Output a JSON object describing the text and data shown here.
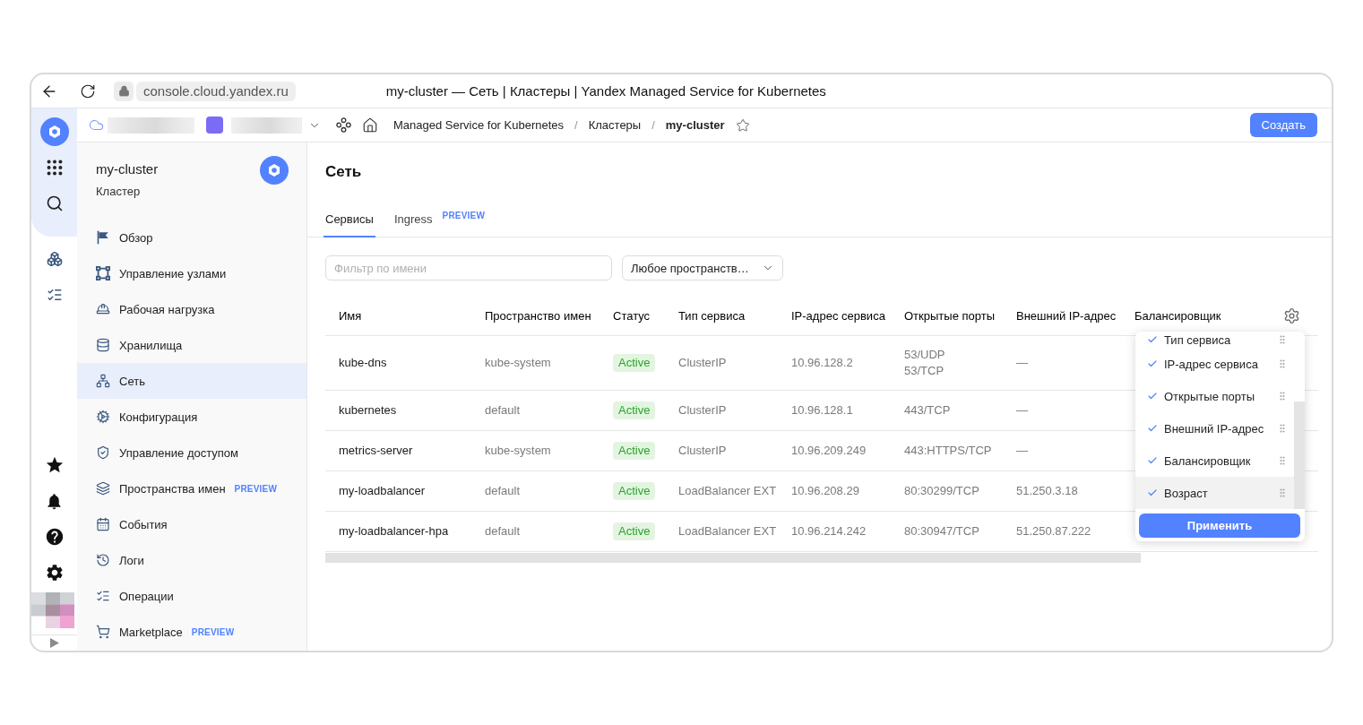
{
  "browser": {
    "url": "console.cloud.yandex.ru",
    "title": "my-cluster — Сеть | Кластеры | Yandex Managed Service for Kubernetes"
  },
  "header": {
    "breadcrumbs": [
      {
        "label": "Managed Service for Kubernetes",
        "current": false
      },
      {
        "separator": "/",
        "label": "Кластеры",
        "current": false
      },
      {
        "separator": "/",
        "label": "my-cluster",
        "current": true
      }
    ],
    "favorite": false,
    "create_button": "Создать"
  },
  "sidebar": {
    "title": "my-cluster",
    "subtitle": "Кластер",
    "items": [
      {
        "label": "Обзор",
        "selected": false
      },
      {
        "label": "Управление узлами",
        "selected": false
      },
      {
        "label": "Рабочая нагрузка",
        "selected": false
      },
      {
        "label": "Хранилища",
        "selected": false
      },
      {
        "label": "Сеть",
        "selected": true
      },
      {
        "label": "Конфигурация",
        "selected": false
      },
      {
        "label": "Управление доступом",
        "selected": false
      },
      {
        "label": "Пространства имен",
        "selected": false,
        "badge": "PREVIEW"
      },
      {
        "label": "События",
        "selected": false
      },
      {
        "label": "Логи",
        "selected": false
      },
      {
        "label": "Операции",
        "selected": false
      },
      {
        "label": "Marketplace",
        "selected": false,
        "badge": "PREVIEW"
      }
    ]
  },
  "content": {
    "title": "Сеть",
    "tabs": [
      {
        "label": "Сервисы",
        "selected": true
      },
      {
        "label": "Ingress",
        "selected": false,
        "badge": "PREVIEW"
      }
    ],
    "filter": {
      "placeholder": "Фильтр по имени"
    },
    "namespace_select": {
      "value": "Любое пространств…"
    },
    "table": {
      "columns": [
        "Имя",
        "Пространство имен",
        "Статус",
        "Тип сервиса",
        "IP-адрес сервиса",
        "Открытые порты",
        "Внешний IP-адрес",
        "Балансировщик"
      ],
      "rows": [
        {
          "name": "kube-dns",
          "namespace": "kube-system",
          "status": "Active",
          "type": "ClusterIP",
          "ip": "10.96.128.2",
          "ports": [
            "53/UDP",
            "53/TCP"
          ],
          "external_ip": "—"
        },
        {
          "name": "kubernetes",
          "namespace": "default",
          "status": "Active",
          "type": "ClusterIP",
          "ip": "10.96.128.1",
          "ports": [
            "443/TCP"
          ],
          "external_ip": "—"
        },
        {
          "name": "metrics-server",
          "namespace": "kube-system",
          "status": "Active",
          "type": "ClusterIP",
          "ip": "10.96.209.249",
          "ports": [
            "443:HTTPS/TCP"
          ],
          "external_ip": "—"
        },
        {
          "name": "my-loadbalancer",
          "namespace": "default",
          "status": "Active",
          "type": "LoadBalancer EXT",
          "ip": "10.96.208.29",
          "ports": [
            "80:30299/TCP"
          ],
          "external_ip": "51.250.3.18"
        },
        {
          "name": "my-loadbalancer-hpa",
          "namespace": "default",
          "status": "Active",
          "type": "LoadBalancer EXT",
          "ip": "10.96.214.242",
          "ports": [
            "80:30947/TCP"
          ],
          "external_ip": "51.250.87.222"
        }
      ]
    },
    "column_menu": {
      "items": [
        {
          "label": "Тип сервиса",
          "checked": true,
          "hovered": false
        },
        {
          "label": "IP-адрес сервиса",
          "checked": true,
          "hovered": false
        },
        {
          "label": "Открытые порты",
          "checked": true,
          "hovered": false
        },
        {
          "label": "Внешний IP-адрес",
          "checked": true,
          "hovered": false
        },
        {
          "label": "Балансировщик",
          "checked": true,
          "hovered": false
        },
        {
          "label": "Возраст",
          "checked": true,
          "hovered": true
        }
      ],
      "apply_button": "Применить"
    }
  }
}
